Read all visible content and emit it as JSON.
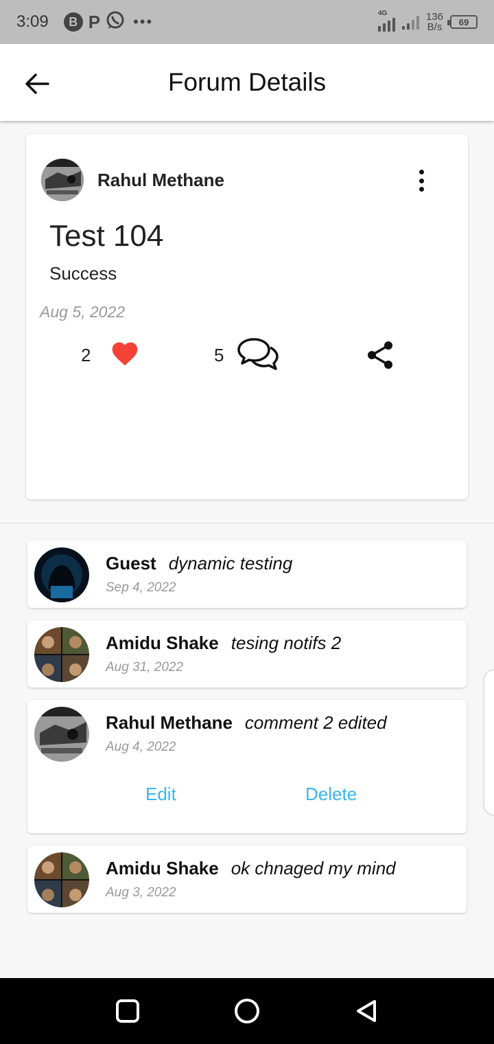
{
  "status_bar": {
    "time": "3:09",
    "left_icons": [
      "b-circle-icon",
      "p-icon",
      "whatsapp-icon",
      "more-dots-icon"
    ],
    "network_label": "4G",
    "speed_value": "136",
    "speed_unit": "B/s",
    "battery": "69"
  },
  "app_bar": {
    "title": "Forum Details",
    "back_icon": "arrow-left-icon"
  },
  "post": {
    "author": "Rahul Methane",
    "title": "Test 104",
    "body": "Success",
    "date": "Aug 5, 2022",
    "likes": "2",
    "comments": "5",
    "like_color": "#f44336"
  },
  "comments": [
    {
      "name": "Guest",
      "text": "dynamic testing",
      "date": "Sep 4, 2022"
    },
    {
      "name": "Amidu Shake",
      "text": "tesing notifs 2",
      "date": "Aug 31, 2022"
    },
    {
      "name": "Rahul Methane",
      "text": "comment 2 edited",
      "date": "Aug 4, 2022",
      "edit_label": "Edit",
      "delete_label": "Delete"
    },
    {
      "name": "Amidu Shake",
      "text": "ok chnaged my mind",
      "date": "Aug 3, 2022"
    }
  ],
  "accent_color": "#38b6f0"
}
